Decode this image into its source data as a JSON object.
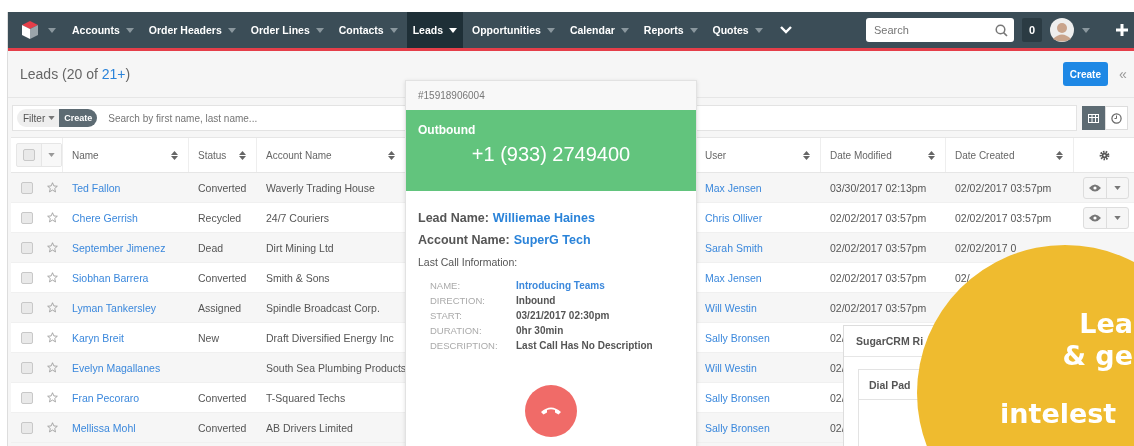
{
  "nav": {
    "items": [
      {
        "label": "Accounts",
        "selected": false
      },
      {
        "label": "Order Headers",
        "selected": false
      },
      {
        "label": "Order Lines",
        "selected": false
      },
      {
        "label": "Contacts",
        "selected": false
      },
      {
        "label": "Leads",
        "selected": true
      },
      {
        "label": "Opportunities",
        "selected": false
      },
      {
        "label": "Calendar",
        "selected": false
      },
      {
        "label": "Reports",
        "selected": false
      },
      {
        "label": "Quotes",
        "selected": false
      }
    ],
    "search": {
      "placeholder": "Search"
    },
    "notifications": "0"
  },
  "header": {
    "title_before": "Leads (20 of ",
    "total": "21+",
    "title_after": ")",
    "create": "Create",
    "collapse": "«"
  },
  "filter": {
    "label": "Filter",
    "create": "Create",
    "placeholder": "Search by first name, last name..."
  },
  "table": {
    "select_all": {
      "checked": false
    },
    "columns": [
      "Name",
      "Status",
      "Account Name",
      "User",
      "Date Modified",
      "Date Created"
    ],
    "rows": [
      {
        "checked": false,
        "favorite": false,
        "name": "Ted Fallon",
        "status": "Converted",
        "account": "Waverly Trading House",
        "user": "Max Jensen",
        "modified": "03/30/2017 02:13pm",
        "created": "02/02/2017 03:57pm",
        "actions": true
      },
      {
        "checked": false,
        "favorite": false,
        "name": "Chere Gerrish",
        "status": "Recycled",
        "account": "24/7 Couriers",
        "user": "Chris Olliver",
        "modified": "02/02/2017 03:57pm",
        "created": "02/02/2017 03:57pm",
        "actions": true
      },
      {
        "checked": false,
        "favorite": false,
        "name": "September Jimenez",
        "status": "Dead",
        "account": "Dirt Mining Ltd",
        "user": "Sarah Smith",
        "modified": "02/02/2017 03:57pm",
        "created": "02/02/2017 0",
        "actions": false
      },
      {
        "checked": false,
        "favorite": false,
        "name": "Siobhan Barrera",
        "status": "Converted",
        "account": "Smith & Sons",
        "user": "Max Jensen",
        "modified": "02/02/2017 03:57pm",
        "created": "02/",
        "actions": false
      },
      {
        "checked": false,
        "favorite": false,
        "name": "Lyman Tankersley",
        "status": "Assigned",
        "account": "Spindle Broadcast Corp.",
        "user": "Will Westin",
        "modified": "02/02/2017 03:57pm",
        "actions": false
      },
      {
        "checked": false,
        "favorite": false,
        "name": "Karyn Breit",
        "status": "New",
        "account": "Draft Diversified Energy Inc",
        "user": "Sally Bronsen",
        "modified": "02/",
        "actions": false
      },
      {
        "checked": false,
        "favorite": false,
        "name": "Evelyn Magallanes",
        "account": "South Sea Plumbing Products",
        "user": "Will Westin",
        "modified": "02/",
        "actions": false
      },
      {
        "checked": false,
        "favorite": false,
        "name": "Fran Pecoraro",
        "status": "Converted",
        "account": "T-Squared Techs",
        "user": "Sally Bronsen",
        "modified": "02/",
        "actions": false
      },
      {
        "checked": false,
        "favorite": false,
        "name": "Mellissa Mohl",
        "status": "Converted",
        "account": "AB Drivers Limited",
        "user": "Sally Bronsen",
        "modified": "02/",
        "actions": false
      }
    ]
  },
  "call": {
    "number_id": "#15918906004",
    "direction": "Outbound",
    "phone": "+1 (933) 2749400",
    "lead_label": "Lead Name:",
    "lead": "Williemae Haines",
    "account_label": "Account Name:",
    "account": "SuperG Tech",
    "last_call_title": "Last Call Information:",
    "details": [
      {
        "label": "NAME:",
        "value": "Introducing Teams",
        "kind": "link"
      },
      {
        "label": "DIRECTION:",
        "value": "Inbound",
        "kind": "text"
      },
      {
        "label": "START:",
        "value": "03/21/2017 02:30pm",
        "kind": "text"
      },
      {
        "label": "DURATION:",
        "value": "0hr 30min",
        "kind": "text"
      },
      {
        "label": "DESCRIPTION:",
        "value": "Last Call Has No Description",
        "kind": "text"
      }
    ]
  },
  "dialer": {
    "title": "SugarCRM Ri",
    "tab": "Dial Pad"
  },
  "promo": {
    "lines": [
      "Lea",
      "& ge",
      "intelest"
    ]
  }
}
